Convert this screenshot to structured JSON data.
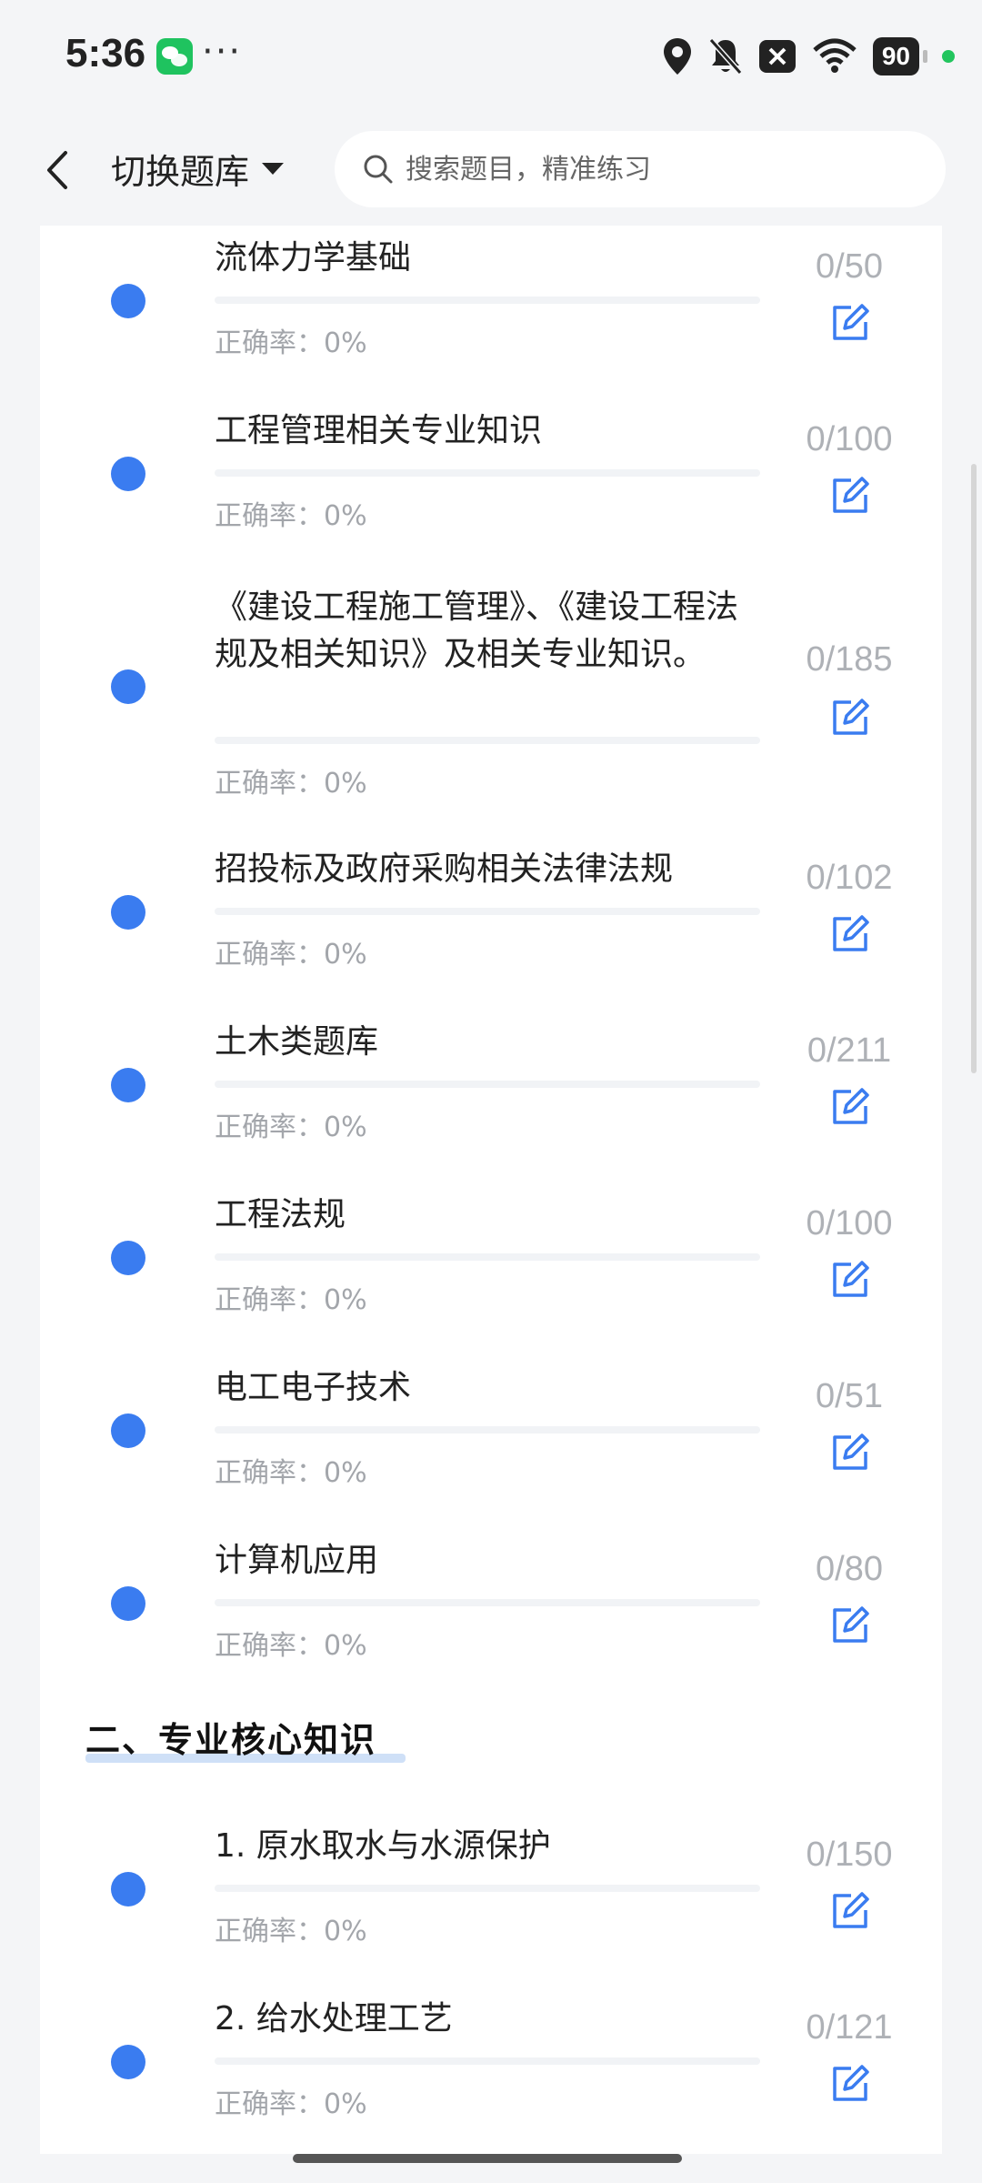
{
  "status_bar": {
    "time": "5:36",
    "more": "···",
    "battery": "90",
    "icons": [
      "wechat-icon",
      "location-icon",
      "mute-bell-icon",
      "close-notification-icon",
      "wifi-icon",
      "battery-icon"
    ]
  },
  "header": {
    "bank_switch_label": "切换题库",
    "search_placeholder": "搜索题目，精准练习"
  },
  "items_top": [
    {
      "title": "流体力学基础",
      "accuracy": "正确率：0%",
      "count": "0/50",
      "progress": 0
    },
    {
      "title": "工程管理相关专业知识",
      "accuracy": "正确率：0%",
      "count": "0/100",
      "progress": 0
    },
    {
      "title": "《建设工程施工管理》、《建设工程法规及相关知识》及相关专业知识。",
      "accuracy": "正确率：0%",
      "count": "0/185",
      "progress": 0
    },
    {
      "title": "招投标及政府采购相关法律法规",
      "accuracy": "正确率：0%",
      "count": "0/102",
      "progress": 0
    },
    {
      "title": "土木类题库",
      "accuracy": "正确率：0%",
      "count": "0/211",
      "progress": 0
    },
    {
      "title": "工程法规",
      "accuracy": "正确率：0%",
      "count": "0/100",
      "progress": 0
    },
    {
      "title": "电工电子技术",
      "accuracy": "正确率：0%",
      "count": "0/51",
      "progress": 0
    },
    {
      "title": "计算机应用",
      "accuracy": "正确率：0%",
      "count": "0/80",
      "progress": 0
    }
  ],
  "section": {
    "title": "二、专业核心知识"
  },
  "items_section": [
    {
      "title": "1. 原水取水与水源保护",
      "accuracy": "正确率：0%",
      "count": "0/150",
      "progress": 0
    },
    {
      "title": "2. 给水处理工艺",
      "accuracy": "正确率：0%",
      "count": "0/121",
      "progress": 0
    }
  ],
  "colors": {
    "accent": "#3a7cf0",
    "background": "#f4f5f7",
    "muted_text": "#a3a6ab"
  }
}
